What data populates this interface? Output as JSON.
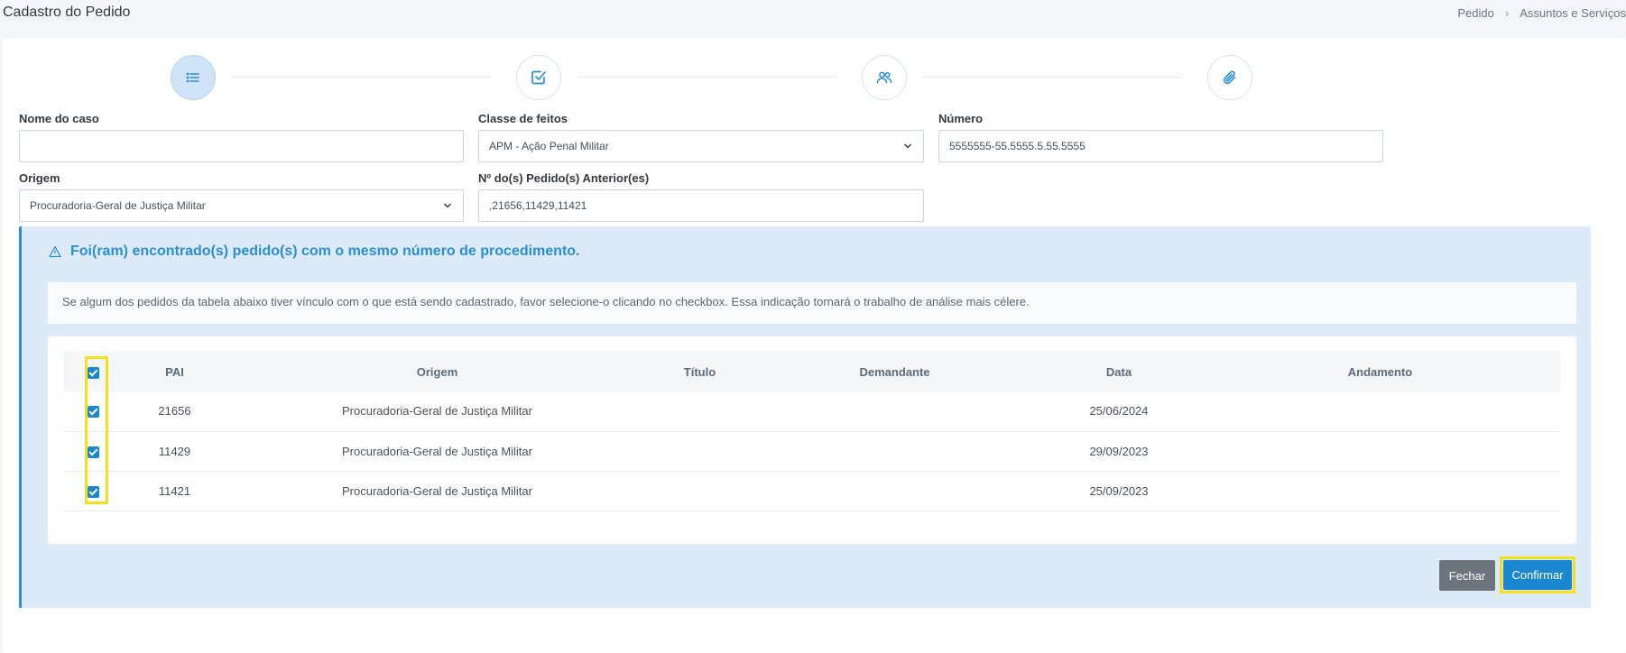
{
  "header": {
    "title": "Cadastro do Pedido",
    "breadcrumb": [
      "Pedido",
      "Assuntos e Serviços"
    ]
  },
  "stepper": {
    "icons": [
      "list-icon",
      "check-square-icon",
      "users-icon",
      "paperclip-icon"
    ],
    "active_index": 0
  },
  "form": {
    "nome_caso": {
      "label": "Nome do caso",
      "value": ""
    },
    "classe_feitos": {
      "label": "Classe de feitos",
      "value": "APM - Ação Penal Militar"
    },
    "numero": {
      "label": "Número",
      "value": "5555555-55.5555.5.55.5555"
    },
    "origem": {
      "label": "Origem",
      "value": "Procuradoria-Geral de Justiça Militar"
    },
    "pedidos_anteriores": {
      "label": "Nº do(s) Pedido(s) Anterior(es)",
      "value": ",21656,11429,11421"
    }
  },
  "alert": {
    "title": "Foi(ram) encontrado(s) pedido(s) com o mesmo número de procedimento.",
    "info": "Se algum dos pedidos da tabela abaixo tiver vínculo com o que está sendo cadastrado, favor selecione-o clicando no checkbox. Essa indicação tornará o trabalho de análise mais célere.",
    "accent_color": "#2a8fd6"
  },
  "table": {
    "columns": [
      "PAI",
      "Origem",
      "Título",
      "Demandante",
      "Data",
      "Andamento"
    ],
    "rows": [
      {
        "checked": true,
        "pai": "21656",
        "origem": "Procuradoria-Geral de Justiça Militar",
        "titulo": "",
        "demandante": "",
        "data": "25/06/2024",
        "andamento": ""
      },
      {
        "checked": true,
        "pai": "11429",
        "origem": "Procuradoria-Geral de Justiça Militar",
        "titulo": "",
        "demandante": "",
        "data": "29/09/2023",
        "andamento": ""
      },
      {
        "checked": true,
        "pai": "11421",
        "origem": "Procuradoria-Geral de Justiça Militar",
        "titulo": "",
        "demandante": "",
        "data": "25/09/2023",
        "andamento": ""
      }
    ]
  },
  "buttons": {
    "fechar": "Fechar",
    "confirmar": "Confirmar"
  }
}
